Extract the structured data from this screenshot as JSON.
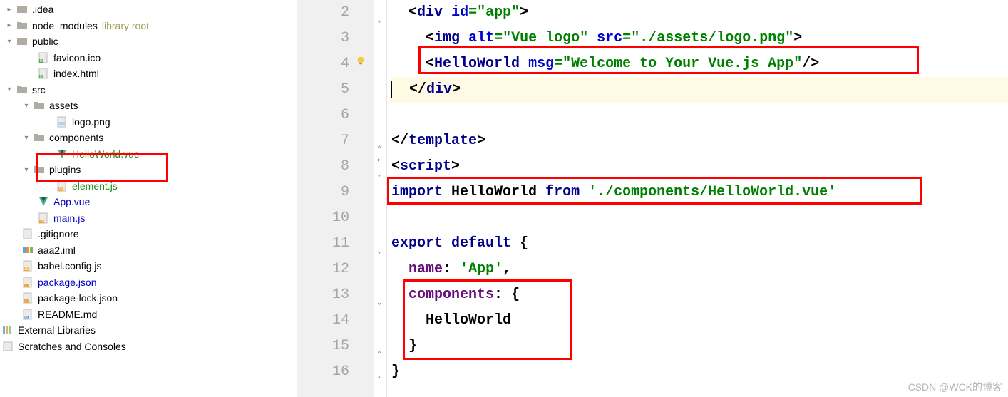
{
  "tree": {
    "idea": {
      "label": ".idea"
    },
    "node_modules": {
      "label": "node_modules",
      "note": "library root"
    },
    "public": {
      "label": "public"
    },
    "favicon": {
      "label": "favicon.ico"
    },
    "indexhtml": {
      "label": "index.html"
    },
    "src": {
      "label": "src"
    },
    "assets": {
      "label": "assets"
    },
    "logopng": {
      "label": "logo.png"
    },
    "components": {
      "label": "components"
    },
    "hellovue": {
      "label": "HelloWorld.vue"
    },
    "plugins": {
      "label": "plugins"
    },
    "elementjs": {
      "label": "element.js"
    },
    "appvue": {
      "label": "App.vue"
    },
    "mainjs": {
      "label": "main.js"
    },
    "gitignore": {
      "label": ".gitignore"
    },
    "aaa2": {
      "label": "aaa2.iml"
    },
    "babel": {
      "label": "babel.config.js"
    },
    "package": {
      "label": "package.json"
    },
    "packagelock": {
      "label": "package-lock.json"
    },
    "readme": {
      "label": "README.md"
    },
    "extlib": {
      "label": "External Libraries"
    },
    "scratches": {
      "label": "Scratches and Consoles"
    }
  },
  "code": {
    "lines": [
      "2",
      "3",
      "4",
      "5",
      "6",
      "7",
      "8",
      "9",
      "10",
      "11",
      "12",
      "13",
      "14",
      "15",
      "16"
    ],
    "l2": {
      "ind": "  ",
      "p1": "<",
      "tag": "div",
      "sp": " ",
      "attr": "id",
      "eq": "=",
      "q": "\"",
      "val": "app",
      "p2": ">"
    },
    "l3": {
      "ind": "    ",
      "p1": "<",
      "tag": "img",
      "sp": " ",
      "attr1": "alt",
      "eq": "=",
      "q": "\"",
      "val1": "Vue logo",
      "sp2": " ",
      "attr2": "src",
      "val2": "./assets/logo.png",
      "p2": ">"
    },
    "l4": {
      "ind": "    ",
      "p1": "<",
      "tag": "HelloWorld",
      "sp": " ",
      "attr": "msg",
      "eq": "=",
      "q": "\"",
      "val": "Welcome to Your Vue.js App",
      "p2": "/>"
    },
    "l5": {
      "ind": "  ",
      "p1": "</",
      "tag": "div",
      "p2": ">"
    },
    "l7": {
      "p1": "</",
      "tag": "template",
      "p2": ">"
    },
    "l8": {
      "p1": "<",
      "tag": "script",
      "p2": ">"
    },
    "l9": {
      "kw1": "import",
      "sp": " ",
      "ident": "HelloWorld",
      "sp2": " ",
      "kw2": "from",
      "sp3": " ",
      "q": "'",
      "path": "./components/HelloWorld.vue"
    },
    "l11": {
      "kw1": "export",
      "sp": " ",
      "kw2": "default",
      "sp2": " ",
      "brace": "{"
    },
    "l12": {
      "ind": "  ",
      "prop": "name",
      "colon": ": ",
      "q": "'",
      "val": "App",
      "comma": ","
    },
    "l13": {
      "ind": "  ",
      "prop": "components",
      "colon": ": ",
      "brace": "{"
    },
    "l14": {
      "ind": "    ",
      "ident": "HelloWorld"
    },
    "l15": {
      "ind": "  ",
      "brace": "}"
    },
    "l16": {
      "brace": "}"
    }
  },
  "watermark": "CSDN @WCK的博客"
}
